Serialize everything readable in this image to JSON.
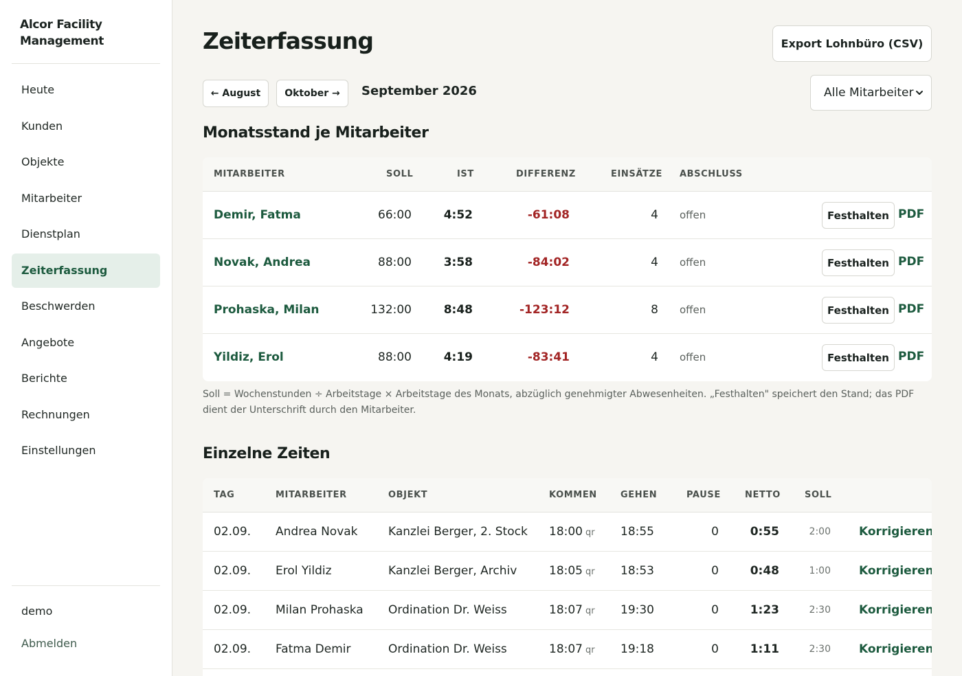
{
  "brand": {
    "name": "Alcor Facility Management"
  },
  "sidebar": {
    "items": [
      {
        "label": "Heute",
        "key": "heute"
      },
      {
        "label": "Kunden",
        "key": "kunden"
      },
      {
        "label": "Objekte",
        "key": "objekte"
      },
      {
        "label": "Mitarbeiter",
        "key": "mitarbeiter"
      },
      {
        "label": "Dienstplan",
        "key": "dienstplan"
      },
      {
        "label": "Zeiterfassung",
        "key": "zeiterfassung",
        "active": true
      },
      {
        "label": "Beschwerden",
        "key": "beschwerden"
      },
      {
        "label": "Angebote",
        "key": "angebote"
      },
      {
        "label": "Berichte",
        "key": "berichte"
      },
      {
        "label": "Rechnungen",
        "key": "rechnungen"
      },
      {
        "label": "Einstellungen",
        "key": "einstellungen"
      }
    ],
    "user": "demo",
    "logout": "Abmelden"
  },
  "header": {
    "title": "Zeiterfassung",
    "export_label": "Export Lohnbüro (CSV)"
  },
  "month_nav": {
    "prev_label": "← August",
    "next_label": "Oktober →",
    "current": "September 2026"
  },
  "filter": {
    "selected": "Alle Mitarbeiter"
  },
  "summary": {
    "title": "Monatsstand je Mitarbeiter",
    "columns": {
      "mitarbeiter": "Mitarbeiter",
      "soll": "Soll",
      "ist": "Ist",
      "differenz": "Differenz",
      "einsaetze": "Einsätze",
      "abschluss": "Abschluss"
    },
    "rows": [
      {
        "name": "Demir, Fatma",
        "soll": "66:00",
        "ist": "4:52",
        "diff": "-61:08",
        "einsaetze": "4",
        "status": "offen",
        "hold": "Festhalten",
        "pdf": "PDF"
      },
      {
        "name": "Novak, Andrea",
        "soll": "88:00",
        "ist": "3:58",
        "diff": "-84:02",
        "einsaetze": "4",
        "status": "offen",
        "hold": "Festhalten",
        "pdf": "PDF"
      },
      {
        "name": "Prohaska, Milan",
        "soll": "132:00",
        "ist": "8:48",
        "diff": "-123:12",
        "einsaetze": "8",
        "status": "offen",
        "hold": "Festhalten",
        "pdf": "PDF"
      },
      {
        "name": "Yildiz, Erol",
        "soll": "88:00",
        "ist": "4:19",
        "diff": "-83:41",
        "einsaetze": "4",
        "status": "offen",
        "hold": "Festhalten",
        "pdf": "PDF"
      }
    ],
    "note": "Soll = Wochenstunden ÷ Arbeitstage × Arbeitstage des Monats, abzüglich genehmigter Abwesenheiten. „Festhalten\" speichert den Stand; das PDF dient der Unterschrift durch den Mitarbeiter."
  },
  "entries": {
    "title": "Einzelne Zeiten",
    "columns": {
      "tag": "Tag",
      "mitarbeiter": "Mitarbeiter",
      "objekt": "Objekt",
      "kommen": "Kommen",
      "gehen": "Gehen",
      "pause": "Pause",
      "netto": "Netto",
      "soll": "Soll"
    },
    "rows": [
      {
        "tag": "02.09.",
        "mitarbeiter": "Andrea Novak",
        "objekt": "Kanzlei Berger, 2. Stock",
        "kommen": "18:00",
        "kommen_tag": "qr",
        "gehen": "18:55",
        "pause": "0",
        "netto": "0:55",
        "soll": "2:00",
        "action": "Korrigieren"
      },
      {
        "tag": "02.09.",
        "mitarbeiter": "Erol Yildiz",
        "objekt": "Kanzlei Berger, Archiv",
        "kommen": "18:05",
        "kommen_tag": "qr",
        "gehen": "18:53",
        "pause": "0",
        "netto": "0:48",
        "soll": "1:00",
        "action": "Korrigieren"
      },
      {
        "tag": "02.09.",
        "mitarbeiter": "Milan Prohaska",
        "objekt": "Ordination Dr. Weiss",
        "kommen": "18:07",
        "kommen_tag": "qr",
        "gehen": "19:30",
        "pause": "0",
        "netto": "1:23",
        "soll": "2:30",
        "action": "Korrigieren"
      },
      {
        "tag": "02.09.",
        "mitarbeiter": "Fatma Demir",
        "objekt": "Ordination Dr. Weiss",
        "kommen": "18:07",
        "kommen_tag": "qr",
        "gehen": "19:18",
        "pause": "0",
        "netto": "1:11",
        "soll": "2:30",
        "action": "Korrigieren"
      }
    ]
  },
  "colors": {
    "accent": "#1c5a3e",
    "negative": "#a22424",
    "active_bg": "#e5efe9",
    "page_bg": "#f6f5f1"
  }
}
